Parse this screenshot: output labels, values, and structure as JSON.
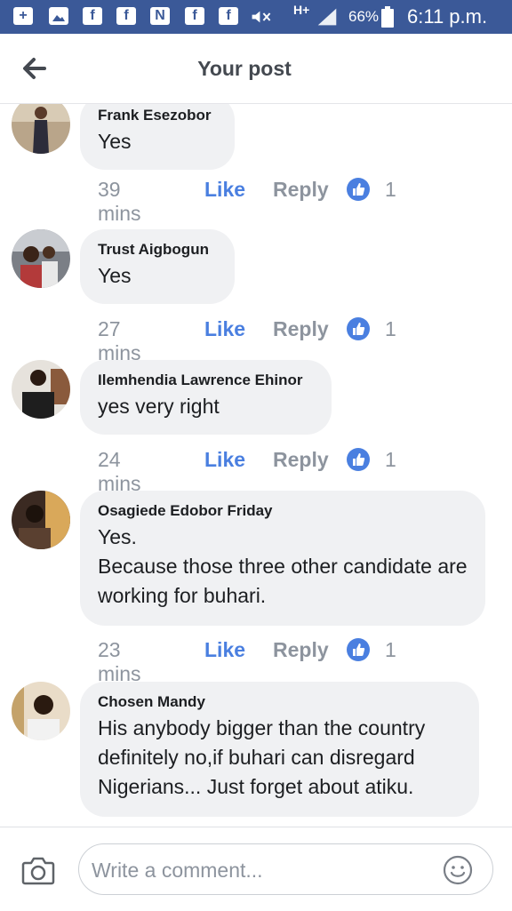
{
  "status_bar": {
    "network": "H+",
    "battery": "66%",
    "time": "6:11 p.m."
  },
  "header": {
    "title": "Your post"
  },
  "comments": [
    {
      "name": "Frank Esezobor",
      "text": "Yes",
      "time": "39 mins",
      "like_label": "Like",
      "reply_label": "Reply",
      "like_count": "1"
    },
    {
      "name": "Trust Aigbogun",
      "text": "Yes",
      "time": "27 mins",
      "like_label": "Like",
      "reply_label": "Reply",
      "like_count": "1"
    },
    {
      "name": "Ilemhendia Lawrence Ehinor",
      "text": "yes very right",
      "time": "24 mins",
      "like_label": "Like",
      "reply_label": "Reply",
      "like_count": "1"
    },
    {
      "name": "Osagiede Edobor Friday",
      "text": "Yes.\nBecause those three other candidate are working for buhari.",
      "time": "23 mins",
      "like_label": "Like",
      "reply_label": "Reply",
      "like_count": "1"
    },
    {
      "name": "Chosen Mandy",
      "text": "His anybody bigger than the country definitely no,if buhari can disregard Nigerians... Just forget about atiku."
    }
  ],
  "composer": {
    "placeholder": "Write a comment..."
  },
  "colors": {
    "brand": "#3b5998",
    "like_blue": "#4a7fe0",
    "bubble_bg": "#f0f1f3"
  }
}
